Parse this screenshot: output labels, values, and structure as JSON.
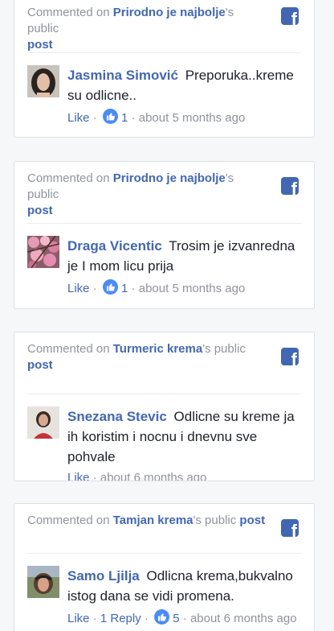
{
  "colors": {
    "brand": "#4267b2",
    "muted": "#90949c",
    "text": "#1d2129"
  },
  "posts": [
    {
      "prefix": "Commented on ",
      "page": "Prirodno je najbolje",
      "suffix": "'s public",
      "post_word": "post",
      "author": "Jasmina Simović",
      "text": "Preporuka..kreme su odlicne..",
      "like": "Like",
      "reactions": "1",
      "time": "about 5 months ago"
    },
    {
      "prefix": "Commented on ",
      "page": "Prirodno je najbolje",
      "suffix": "'s public",
      "post_word": "post",
      "author": "Draga Vicentic",
      "text": "Trosim je izvanredna je I mom licu prija",
      "like": "Like",
      "reactions": "1",
      "time": "about 5 months ago"
    },
    {
      "prefix": "Commented on ",
      "page": "Turmeric krema",
      "suffix": "'s public",
      "post_word": "post",
      "author": "Snezana Stevic",
      "text": "Odlicne su kreme ja ih koristim i nocnu i dnevnu sve pohvale",
      "like": "Like",
      "time": "about 6 months ago"
    },
    {
      "prefix": "Commented on ",
      "page": "Tamjan krema",
      "suffix": "'s public ",
      "post_word": "post",
      "author": "Samo Ljilja",
      "text": "Odlicna krema,bukvalno istog dana se vidi promena.",
      "like": "Like",
      "reply": "1 Reply",
      "reactions": "5",
      "time": "about 6 months ago"
    }
  ]
}
